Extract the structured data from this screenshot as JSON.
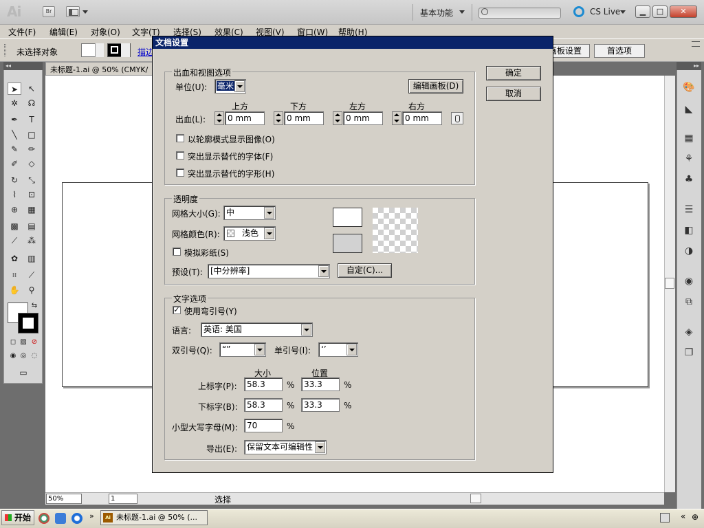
{
  "app": {
    "logo": "Ai",
    "bridge_label": "Br",
    "workspace": "基本功能",
    "cs_live": "CS Live",
    "min": "▁",
    "max": "□",
    "close": "✕"
  },
  "menu": [
    "文件(F)",
    "编辑(E)",
    "对象(O)",
    "文字(T)",
    "选择(S)",
    "效果(C)",
    "视图(V)",
    "窗口(W)",
    "帮助(H)"
  ],
  "control": {
    "no_selection": "未选择对象",
    "stroke_label": "描边",
    "artboard_btn": "画板设置",
    "prefs_btn": "首选项"
  },
  "document": {
    "tab": "未标题-1.ai @ 50% (CMYK/",
    "zoom": "50%",
    "page": "1",
    "status": "选择"
  },
  "taskbar": {
    "start": "开始",
    "task": "未标题-1.ai @ 50% (..."
  },
  "dialog": {
    "title": "文档设置",
    "ok": "确定",
    "cancel": "取消",
    "bleed": {
      "group": "出血和视图选项",
      "unit_label": "单位(U):",
      "unit_value": "毫米",
      "edit_artboard": "编辑画板(D)",
      "bleed_label": "出血(L):",
      "top_label": "上方",
      "bottom_label": "下方",
      "left_label": "左方",
      "right_label": "右方",
      "top": "0 mm",
      "bottom": "0 mm",
      "left": "0 mm",
      "right": "0 mm",
      "opt_outline": "以轮廓模式显示图像(O)",
      "opt_font": "突出显示替代的字体(F)",
      "opt_glyph": "突出显示替代的字形(H)"
    },
    "transparency": {
      "group": "透明度",
      "grid_size_label": "网格大小(G):",
      "grid_size": "中",
      "grid_color_label": "网格颜色(R):",
      "grid_color": "浅色",
      "sim_paper": "模拟彩纸(S)",
      "preset_label": "预设(T):",
      "preset": "[中分辨率]",
      "custom": "自定(C)..."
    },
    "type": {
      "group": "文字选项",
      "smart_quotes": "使用弯引号(Y)",
      "check_mark": "✓",
      "language_label": "语言:",
      "language": "英语: 美国",
      "dquote_label": "双引号(Q):",
      "dquote": "“”",
      "squote_label": "单引号(I):",
      "squote": "‘’",
      "size_header": "大小",
      "position_header": "位置",
      "superscript_label": "上标字(P):",
      "super_size": "58.3",
      "super_pos": "33.3",
      "subscript_label": "下标字(B):",
      "sub_size": "58.3",
      "sub_pos": "33.3",
      "smallcaps_label": "小型大写字母(M):",
      "smallcaps": "70",
      "pct": "%",
      "export_label": "导出(E):",
      "export": "保留文本可编辑性"
    }
  }
}
